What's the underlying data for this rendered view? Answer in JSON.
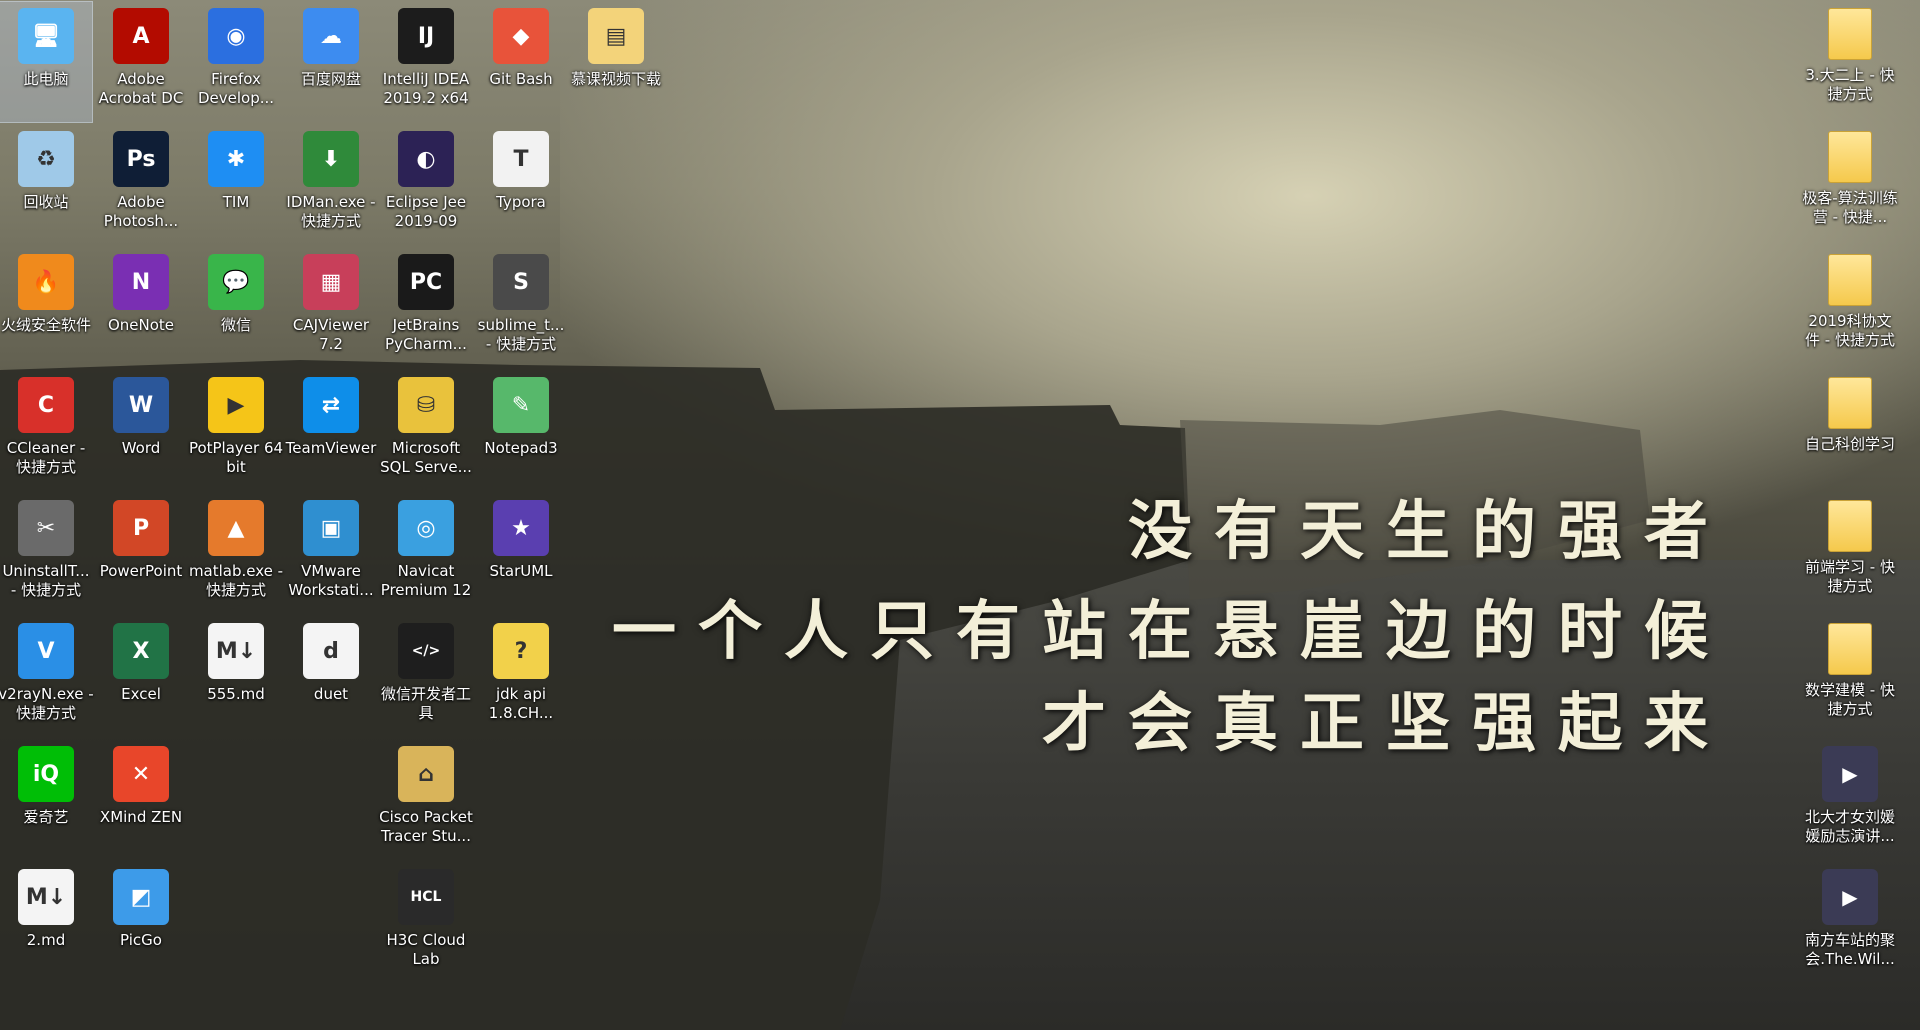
{
  "desktop": {
    "quote_lines": [
      "没有天生的强者",
      "一个人只有站在悬崖边的时候",
      "才会真正坚强起来"
    ],
    "icons_left": [
      {
        "label": "此电脑",
        "icon": "computer-icon",
        "glyph": "🖥",
        "bg": "#5ab4f0",
        "selected": true
      },
      {
        "label": "Adobe Acrobat DC",
        "icon": "acrobat-icon",
        "glyph": "A",
        "bg": "#b30b00"
      },
      {
        "label": "Firefox Develop...",
        "icon": "firefox-icon",
        "glyph": "◉",
        "bg": "#2b6fe0"
      },
      {
        "label": "百度网盘",
        "icon": "baidu-netdisk-icon",
        "glyph": "☁",
        "bg": "#3d8cf0"
      },
      {
        "label": "IntelliJ IDEA 2019.2 x64",
        "icon": "intellij-icon",
        "glyph": "IJ",
        "bg": "#1c1c1c"
      },
      {
        "label": "Git Bash",
        "icon": "git-bash-icon",
        "glyph": "◆",
        "bg": "#e8533a"
      },
      {
        "label": "慕课视频下载",
        "icon": "file-icon",
        "glyph": "▤",
        "bg": "#f3d37a"
      },
      {
        "label": "回收站",
        "icon": "recycle-bin-icon",
        "glyph": "♻",
        "bg": "#9fc9e8"
      },
      {
        "label": "Adobe Photosh...",
        "icon": "photoshop-icon",
        "glyph": "Ps",
        "bg": "#0f1e36"
      },
      {
        "label": "TIM",
        "icon": "tim-icon",
        "glyph": "✱",
        "bg": "#1e8ef3"
      },
      {
        "label": "IDMan.exe - 快捷方式",
        "icon": "idm-icon",
        "glyph": "⬇",
        "bg": "#2f8a3a"
      },
      {
        "label": "Eclipse Jee 2019-09",
        "icon": "eclipse-icon",
        "glyph": "◐",
        "bg": "#2c2255"
      },
      {
        "label": "Typora",
        "icon": "typora-icon",
        "glyph": "T",
        "bg": "#f2f2f2"
      },
      {
        "label": "火绒安全软件",
        "icon": "huorong-icon",
        "glyph": "🔥",
        "bg": "#f08a1c"
      },
      {
        "label": "OneNote",
        "icon": "onenote-icon",
        "glyph": "N",
        "bg": "#7a2fb3"
      },
      {
        "label": "微信",
        "icon": "wechat-icon",
        "glyph": "💬",
        "bg": "#39b54a"
      },
      {
        "label": "CAJViewer 7.2",
        "icon": "cajviewer-icon",
        "glyph": "▦",
        "bg": "#c83f5a"
      },
      {
        "label": "JetBrains PyCharm...",
        "icon": "pycharm-icon",
        "glyph": "PC",
        "bg": "#1a1a1a"
      },
      {
        "label": "sublime_t... - 快捷方式",
        "icon": "sublime-icon",
        "glyph": "S",
        "bg": "#4a4a4a"
      },
      {
        "label": "CCleaner - 快捷方式",
        "icon": "ccleaner-icon",
        "glyph": "C",
        "bg": "#d8302a"
      },
      {
        "label": "Word",
        "icon": "word-icon",
        "glyph": "W",
        "bg": "#2b579a"
      },
      {
        "label": "PotPlayer 64 bit",
        "icon": "potplayer-icon",
        "glyph": "▶",
        "bg": "#f5c518"
      },
      {
        "label": "TeamViewer",
        "icon": "teamviewer-icon",
        "glyph": "⇄",
        "bg": "#0e8ee9"
      },
      {
        "label": "Microsoft SQL Serve...",
        "icon": "sql-server-icon",
        "glyph": "⛁",
        "bg": "#e9c23c"
      },
      {
        "label": "Notepad3",
        "icon": "notepad3-icon",
        "glyph": "✎",
        "bg": "#57b86b"
      },
      {
        "label": "UninstallT... - 快捷方式",
        "icon": "uninstall-tool-icon",
        "glyph": "✂",
        "bg": "#6a6a6a"
      },
      {
        "label": "PowerPoint",
        "icon": "powerpoint-icon",
        "glyph": "P",
        "bg": "#d24726"
      },
      {
        "label": "matlab.exe - 快捷方式",
        "icon": "matlab-icon",
        "glyph": "▲",
        "bg": "#e57a2c"
      },
      {
        "label": "VMware Workstati...",
        "icon": "vmware-icon",
        "glyph": "▣",
        "bg": "#2f8fd0"
      },
      {
        "label": "Navicat Premium 12",
        "icon": "navicat-icon",
        "glyph": "◎",
        "bg": "#3aa0e0"
      },
      {
        "label": "StarUML",
        "icon": "staruml-icon",
        "glyph": "★",
        "bg": "#5a3fb0"
      },
      {
        "label": "v2rayN.exe - 快捷方式",
        "icon": "v2rayn-icon",
        "glyph": "V",
        "bg": "#2a8fe6"
      },
      {
        "label": "Excel",
        "icon": "excel-icon",
        "glyph": "X",
        "bg": "#217346"
      },
      {
        "label": "555.md",
        "icon": "markdown-file-icon",
        "glyph": "M↓",
        "bg": "#f4f4f4"
      },
      {
        "label": "duet",
        "icon": "duet-icon",
        "glyph": "d",
        "bg": "#f4f4f4"
      },
      {
        "label": "微信开发者工具",
        "icon": "wechat-devtools-icon",
        "glyph": "</>",
        "bg": "#1e1e1e"
      },
      {
        "label": "jdk api 1.8.CH...",
        "icon": "chm-help-icon",
        "glyph": "?",
        "bg": "#f2d14a"
      },
      {
        "label": "爱奇艺",
        "icon": "iqiyi-icon",
        "glyph": "iQ",
        "bg": "#00be06"
      },
      {
        "label": "XMind ZEN",
        "icon": "xmind-icon",
        "glyph": "✕",
        "bg": "#e8462a"
      },
      {
        "label": "Cisco Packet Tracer Stu...",
        "icon": "packet-tracer-icon",
        "glyph": "⌂",
        "bg": "#d9b45a"
      },
      {
        "label": "2.md",
        "icon": "markdown-file-icon",
        "glyph": "M↓",
        "bg": "#f4f4f4"
      },
      {
        "label": "PicGo",
        "icon": "picgo-icon",
        "glyph": "◩",
        "bg": "#3d9be9"
      },
      {
        "label": "H3C Cloud Lab",
        "icon": "h3c-cloud-lab-icon",
        "glyph": "HCL",
        "bg": "#2a2a2a"
      }
    ],
    "icons_right": [
      {
        "label": "3.大二上 - 快捷方式",
        "icon": "folder-shortcut-icon"
      },
      {
        "label": "极客-算法训练营 - 快捷...",
        "icon": "folder-shortcut-icon"
      },
      {
        "label": "2019科协文件 - 快捷方式",
        "icon": "folder-shortcut-icon"
      },
      {
        "label": "自己科创学习",
        "icon": "folder-icon"
      },
      {
        "label": "前端学习 - 快捷方式",
        "icon": "folder-shortcut-icon"
      },
      {
        "label": "数学建模 - 快捷方式",
        "icon": "folder-shortcut-icon"
      },
      {
        "label": "北大才女刘媛媛励志演讲...",
        "icon": "video-file-icon"
      },
      {
        "label": "南方车站的聚会.The.Wil...",
        "icon": "video-file-icon"
      }
    ]
  }
}
